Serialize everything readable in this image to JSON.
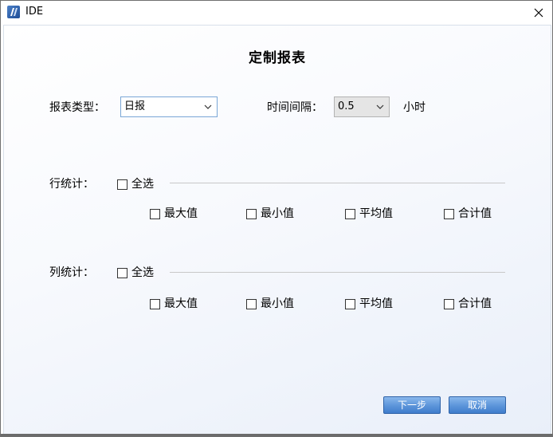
{
  "window": {
    "title": "IDE"
  },
  "dialog": {
    "heading": "定制报表"
  },
  "report_type": {
    "label": "报表类型：",
    "value": "日报"
  },
  "interval": {
    "label": "时间间隔：",
    "value": "0.5",
    "unit": "小时"
  },
  "row_stats": {
    "label": "行统计：",
    "select_all": "全选",
    "options": [
      "最大值",
      "最小值",
      "平均值",
      "合计值"
    ]
  },
  "col_stats": {
    "label": "列统计：",
    "select_all": "全选",
    "options": [
      "最大值",
      "最小值",
      "平均值",
      "合计值"
    ]
  },
  "buttons": {
    "next": "下一步",
    "cancel": "取消"
  }
}
